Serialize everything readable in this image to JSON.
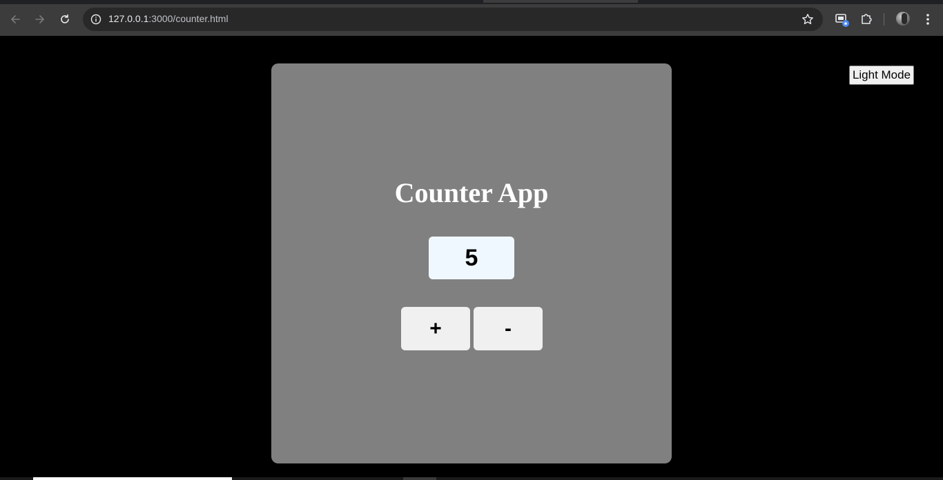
{
  "browser": {
    "url_host": "127.0.0.1",
    "url_rest": ":3000/counter.html",
    "icons": {
      "back": "arrow-left-icon",
      "forward": "arrow-right-icon",
      "reload": "reload-icon",
      "site_info": "info-icon",
      "bookmark": "star-icon",
      "cast": "screen-share-icon",
      "extensions": "puzzle-icon",
      "profile": "avatar",
      "menu": "kebab-menu-icon"
    }
  },
  "page": {
    "theme_toggle_label": "Light Mode",
    "title": "Counter App",
    "count": "5",
    "increment_label": "+",
    "decrement_label": "-"
  },
  "colors": {
    "page_background": "#000000",
    "card_background": "#808080",
    "title_color": "#ffffff",
    "count_background": "#f0f8ff",
    "button_background": "#f0f0f0",
    "chrome_background": "#3c3c3c",
    "omnibox_background": "#282828"
  }
}
